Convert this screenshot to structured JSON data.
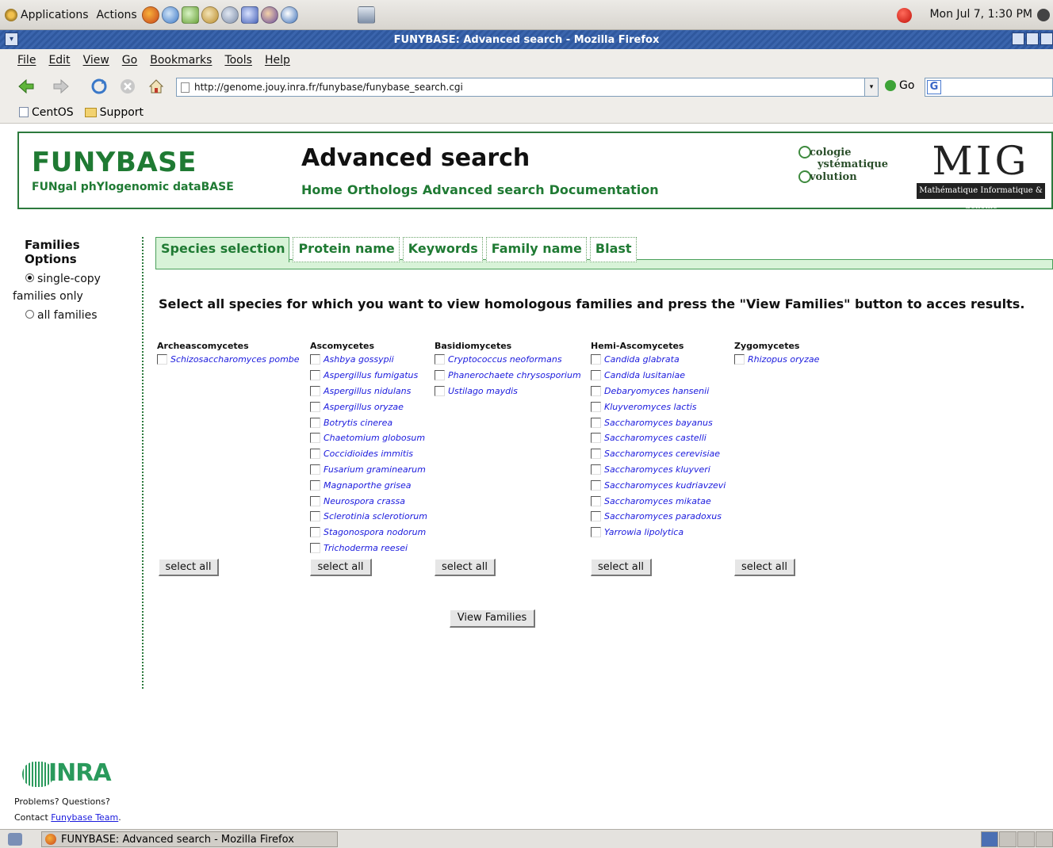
{
  "panel": {
    "applications": "Applications",
    "actions": "Actions",
    "clock": "Mon Jul  7,  1:30 PM"
  },
  "window": {
    "title": "FUNYBASE: Advanced search - Mozilla Firefox"
  },
  "menubar": [
    "File",
    "Edit",
    "View",
    "Go",
    "Bookmarks",
    "Tools",
    "Help"
  ],
  "navbar": {
    "url": "http://genome.jouy.inra.fr/funybase/funybase_search.cgi",
    "go_label": "Go",
    "search_logo_letter": "G"
  },
  "bookmarks": [
    "CentOS",
    "Support"
  ],
  "site": {
    "logo_title": "FUNYBASE",
    "logo_subtitle": "FUNgal phYlogenomic dataBASE",
    "page_title": "Advanced search",
    "nav_links": [
      "Home",
      "Orthologs",
      "Advanced search",
      "Documentation"
    ],
    "ese_lines": [
      "cologie",
      "ystématique",
      "volution"
    ],
    "mig_letters": "MIG",
    "mig_caption": "Mathématique Informatique & Génome"
  },
  "sidebar": {
    "title": "Families Options",
    "options": [
      {
        "label": "single-copy",
        "label2": "families only",
        "selected": true
      },
      {
        "label": "all families",
        "selected": false
      }
    ]
  },
  "tabs": [
    "Species selection",
    "Protein name",
    "Keywords",
    "Family name",
    "Blast"
  ],
  "instruction": "Select all species for which you want to view homologous families and press the \"View Families\" button to acces results.",
  "groups": [
    {
      "name": "Archeascomycetes",
      "species": [
        "Schizosaccharomyces pombe"
      ]
    },
    {
      "name": "Ascomycetes",
      "species": [
        "Ashbya gossypii",
        "Aspergillus fumigatus",
        "Aspergillus nidulans",
        "Aspergillus oryzae",
        "Botrytis cinerea",
        "Chaetomium globosum",
        "Coccidioides immitis",
        "Fusarium graminearum",
        "Magnaporthe grisea",
        "Neurospora crassa",
        "Sclerotinia sclerotiorum",
        "Stagonospora nodorum",
        "Trichoderma reesei"
      ]
    },
    {
      "name": "Basidiomycetes",
      "species": [
        "Cryptococcus neoformans",
        "Phanerochaete chrysosporium",
        "Ustilago maydis"
      ]
    },
    {
      "name": "Hemi-Ascomycetes",
      "species": [
        "Candida glabrata",
        "Candida lusitaniae",
        "Debaryomyces hansenii",
        "Kluyveromyces lactis",
        "Saccharomyces bayanus",
        "Saccharomyces castelli",
        "Saccharomyces cerevisiae",
        "Saccharomyces kluyveri",
        "Saccharomyces kudriavzevi",
        "Saccharomyces mikatae",
        "Saccharomyces paradoxus",
        "Yarrowia lipolytica"
      ]
    },
    {
      "name": "Zygomycetes",
      "species": [
        "Rhizopus oryzae"
      ]
    }
  ],
  "select_all_label": "select all",
  "view_families_label": "View Families",
  "footer": {
    "inra_word": "INRA",
    "problems": "Problems? Questions?",
    "contact_prefix": "Contact ",
    "contact_link": "Funybase Team",
    "contact_suffix": "."
  },
  "taskbar": {
    "task_label": "FUNYBASE: Advanced search - Mozilla Firefox"
  },
  "colors": {
    "brand_green": "#1f7a33",
    "link_blue": "#1a1add",
    "titlebar_blue": "#3b65ad"
  }
}
